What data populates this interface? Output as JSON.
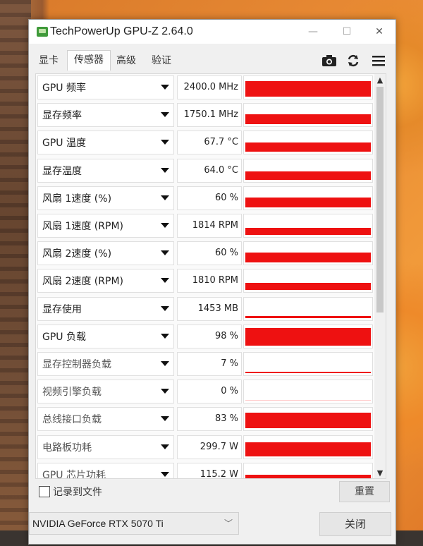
{
  "window": {
    "title": "TechPowerUp GPU-Z 2.64.0",
    "minimize_glyph": "—",
    "maximize_glyph": "☐",
    "close_glyph": "✕"
  },
  "tabs": [
    {
      "label": "显卡",
      "active": false
    },
    {
      "label": "传感器",
      "active": true
    },
    {
      "label": "高级",
      "active": false
    },
    {
      "label": "验证",
      "active": false
    }
  ],
  "toolbar": {
    "screenshot_icon": "camera-icon",
    "refresh_icon": "refresh-icon",
    "menu_icon": "hamburger-menu-icon"
  },
  "sensors": [
    {
      "name": "GPU 频率",
      "value": "2400.0 MHz",
      "level": 0.85
    },
    {
      "name": "显存频率",
      "value": "1750.1 MHz",
      "level": 0.55
    },
    {
      "name": "GPU 温度",
      "value": "67.7 °C",
      "level": 0.5
    },
    {
      "name": "显存温度",
      "value": "64.0 °C",
      "level": 0.45
    },
    {
      "name": "风扇 1速度 (%)",
      "value": "60 %",
      "level": 0.55
    },
    {
      "name": "风扇 1速度 (RPM)",
      "value": "1814 RPM",
      "level": 0.4
    },
    {
      "name": "风扇 2速度 (%)",
      "value": "60 %",
      "level": 0.55
    },
    {
      "name": "风扇 2速度 (RPM)",
      "value": "1810 RPM",
      "level": 0.4
    },
    {
      "name": "显存使用",
      "value": "1453 MB",
      "level": 0.1
    },
    {
      "name": "GPU 负载",
      "value": "98 %",
      "level": 0.98
    },
    {
      "name": "显存控制器负载",
      "value": "7 %",
      "level": 0.07
    },
    {
      "name": "视频引擎负载",
      "value": "0 %",
      "level": 0.0
    },
    {
      "name": "总线接口负载",
      "value": "83 %",
      "level": 0.83
    },
    {
      "name": "电路板功耗",
      "value": "299.7 W",
      "level": 0.78
    },
    {
      "name": "GPU 芯片功耗",
      "value": "115.2 W",
      "level": 0.5
    }
  ],
  "footer": {
    "log_label": "记录到文件",
    "log_checked": false,
    "reset_label": "重置",
    "device": "NVIDIA GeForce RTX 5070 Ti",
    "close_label": "关闭"
  },
  "colors": {
    "graph_fill": "#ee1111"
  }
}
